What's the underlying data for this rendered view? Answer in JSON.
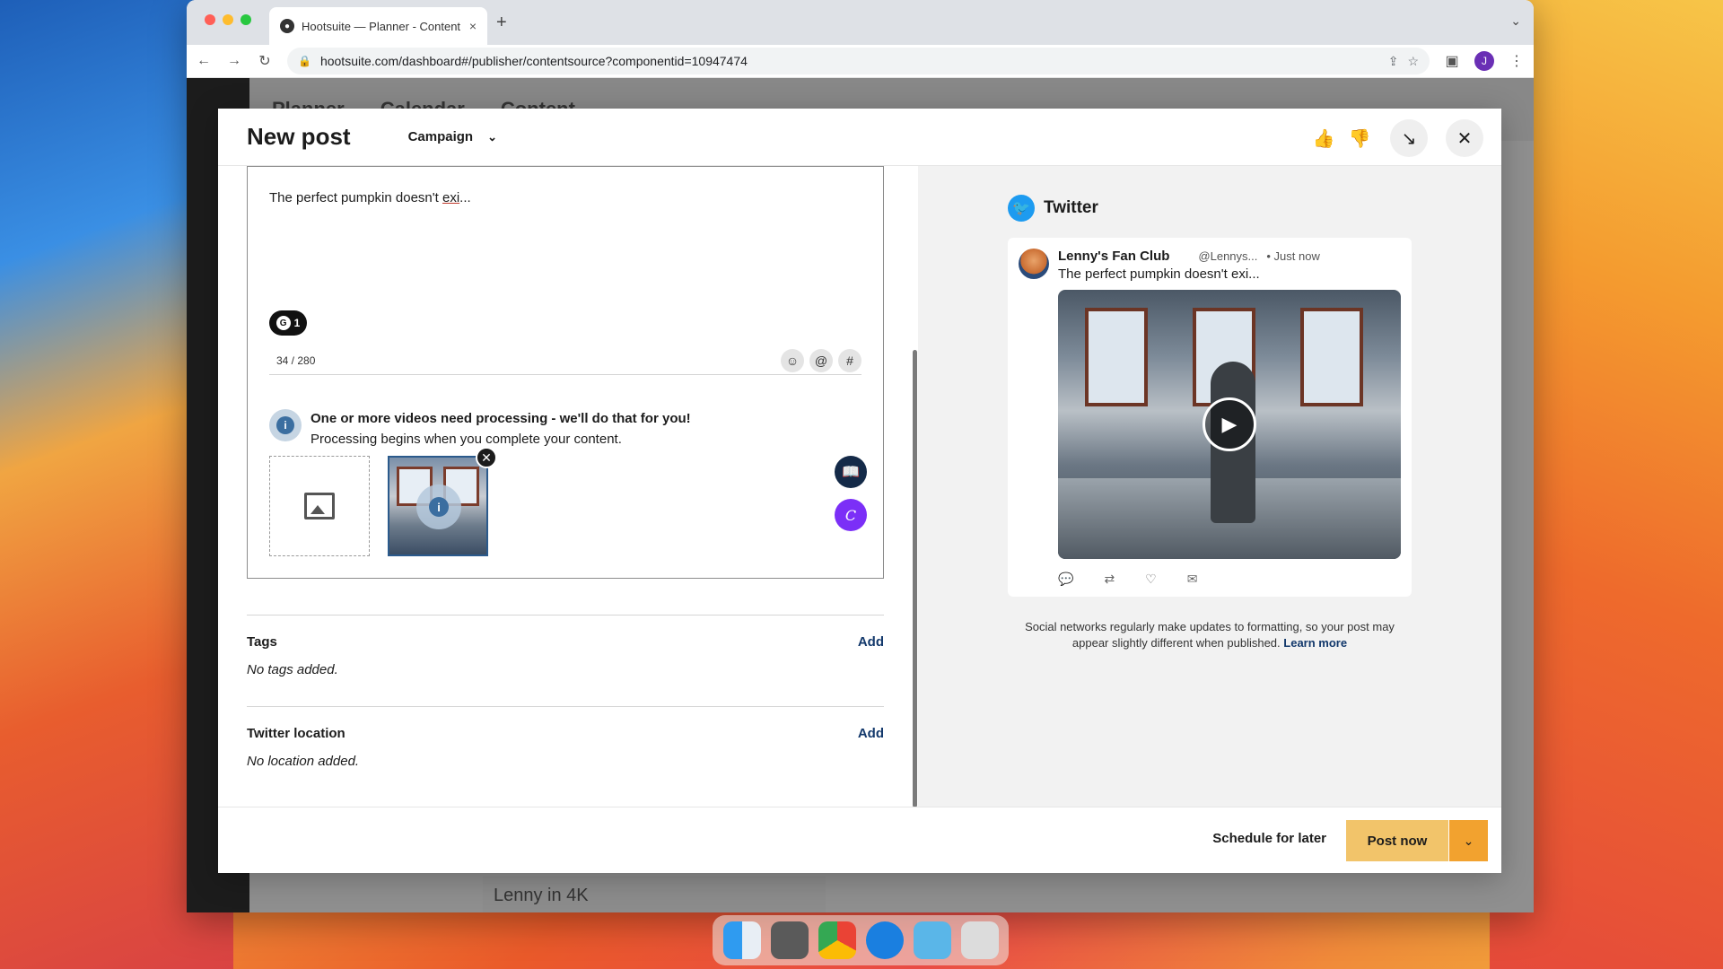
{
  "browser": {
    "tab_title": "Hootsuite — Planner - Content",
    "tab_close": "×",
    "new_tab": "+",
    "url": "hootsuite.com/dashboard#/publisher/contentsource?componentid=10947474",
    "profile_initial": "J"
  },
  "app": {
    "header_tabs": [
      "Planner",
      "Calendar",
      "Content"
    ],
    "bottom_item": "Lenny in 4K"
  },
  "modal": {
    "title": "New post",
    "campaign_label": "Campaign",
    "composer": {
      "text_before": "The perfect pumpkin doesn't ",
      "text_underlined": "exi",
      "text_after": "...",
      "grammarly_count": "1",
      "char_counter": "34 / 280",
      "tool_emoji": "☺",
      "tool_mention": "@",
      "tool_hashtag": "#"
    },
    "processing_notice": {
      "title": "One or more videos need processing - we'll do that for you!",
      "body": "Processing begins when you complete your content."
    },
    "tags": {
      "label": "Tags",
      "add": "Add",
      "empty": "No tags added."
    },
    "location": {
      "label": "Twitter location",
      "add": "Add",
      "empty": "No location added."
    },
    "preview": {
      "network": "Twitter",
      "account_name": "Lenny's Fan Club",
      "handle": "@Lennys...",
      "time": "• Just now",
      "text": "The perfect pumpkin doesn't exi...",
      "disclaimer": "Social networks regularly make updates to formatting, so your post may appear slightly different when published.",
      "learn_more": "Learn more"
    },
    "footer": {
      "schedule_label": "Schedule for later",
      "post_now_label": "Post now"
    }
  },
  "colors": {
    "primary_button": "#f2c46a",
    "dropdown_button": "#f2a22f",
    "link": "#12386b",
    "twitter": "#1d9bf0",
    "canva": "#7b2ff7"
  }
}
